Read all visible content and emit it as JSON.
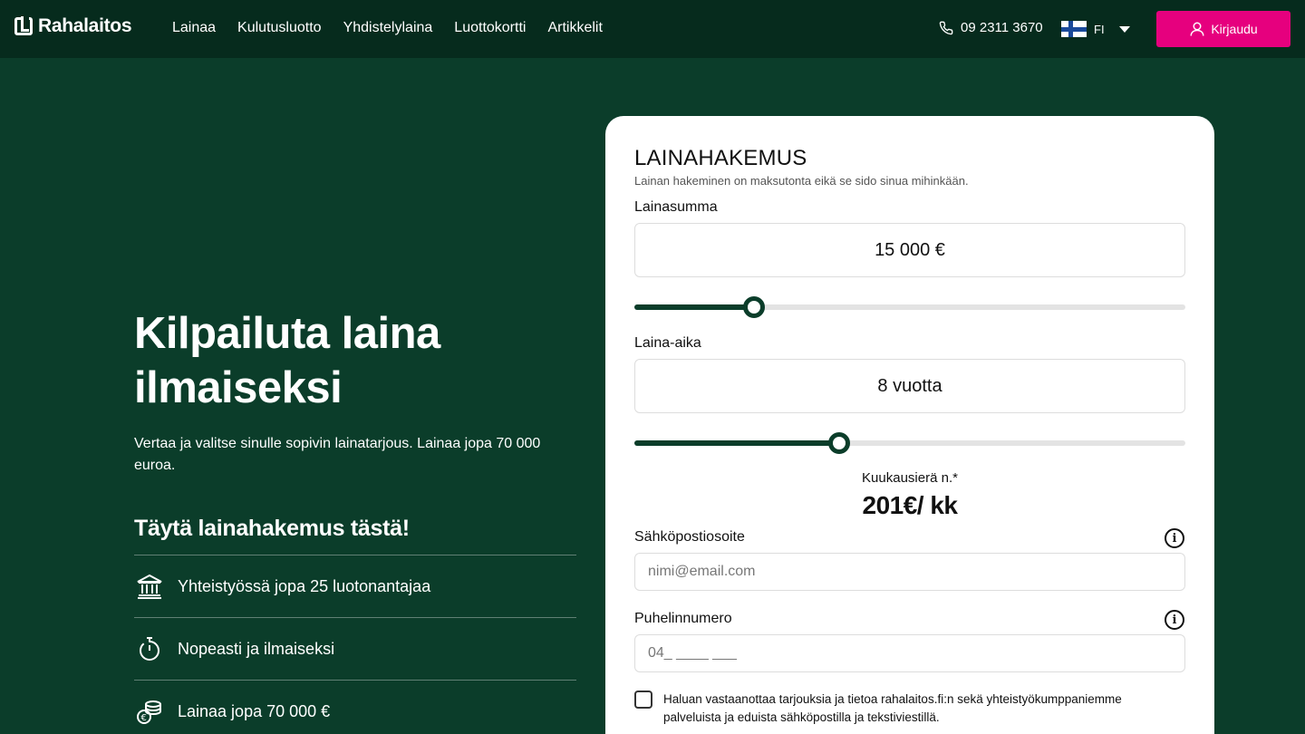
{
  "header": {
    "logo": "Rahalaitos",
    "nav": [
      "Lainaa",
      "Kulutusluotto",
      "Yhdistelylaina",
      "Luottokortti",
      "Artikkelit"
    ],
    "phone": "09 2311 3670",
    "language": "FI",
    "login_label": "Kirjaudu"
  },
  "hero": {
    "title": "Kilpailuta laina ilmaiseksi",
    "subtitle": "Vertaa ja valitse sinulle sopivin lainatarjous. Lainaa jopa 70 000 euroa.",
    "cta_heading": "Täytä lainahakemus tästä!",
    "features": [
      {
        "icon": "bank-icon",
        "label": "Yhteistyössä jopa 25 luotonantajaa"
      },
      {
        "icon": "stopwatch-icon",
        "label": "Nopeasti ja ilmaiseksi"
      },
      {
        "icon": "coins-icon",
        "label": "Lainaa jopa 70 000 €"
      }
    ]
  },
  "form": {
    "title": "LAINAHAKEMUS",
    "subtitle": "Lainan hakeminen on maksutonta eikä se sido sinua mihinkään.",
    "amount_label": "Lainasumma",
    "amount_value": "15 000 €",
    "amount_slider_fraction": 0.217,
    "term_label": "Laina-aika",
    "term_value": "8 vuotta",
    "term_slider_fraction": 0.372,
    "monthly_label": "Kuukausierä n.*",
    "monthly_value": "201€/ kk",
    "email_label": "Sähköpostiosoite",
    "email_placeholder": "nimi@email.com",
    "phone_label": "Puhelinnumero",
    "phone_placeholder": "04_ ____ ___",
    "consent_text": "Haluan vastaanottaa tarjouksia ja tietoa rahalaitos.fi:n sekä yhteistyökumppaniemme palveluista ja eduista sähköpostilla ja tekstiviestillä.",
    "consent_checked": false
  },
  "colors": {
    "brand_green": "#0b3d2a",
    "header_green": "#062b1d",
    "accent_pink": "#e6007e"
  }
}
